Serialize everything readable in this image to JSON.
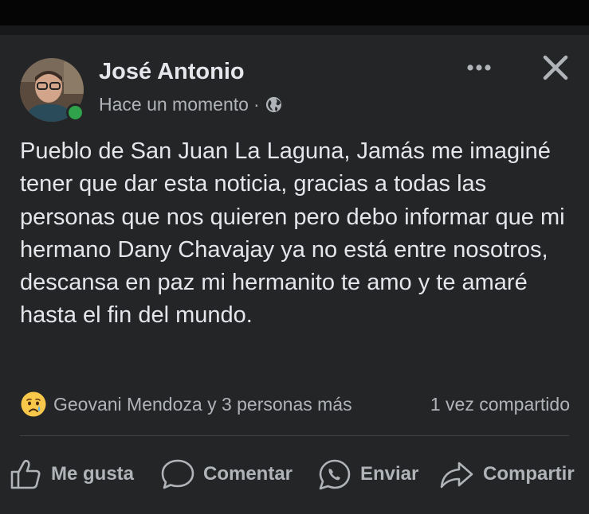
{
  "post": {
    "author": "José Antonio",
    "time": "Hace un momento",
    "separator": "·",
    "privacy_icon": "globe-icon",
    "body": "Pueblo de San Juan La Laguna, Jamás me imaginé tener que dar esta noticia, gracias a todas las personas que nos quieren pero debo informar que mi hermano Dany Chavajay ya no está entre nosotros, descansa en paz mi hermanito te amo y te amaré hasta el fin del mundo.",
    "reaction_icon": "sad-emoji-icon",
    "reactions_text": "Geovani Mendoza y 3 personas más",
    "shares_text": "1 vez compartido"
  },
  "actions": {
    "like": "Me gusta",
    "comment": "Comentar",
    "send": "Enviar",
    "share": "Compartir"
  },
  "colors": {
    "background": "#242526",
    "text_primary": "#e4e6eb",
    "text_secondary": "#b0b3b8",
    "online": "#31a24c"
  }
}
